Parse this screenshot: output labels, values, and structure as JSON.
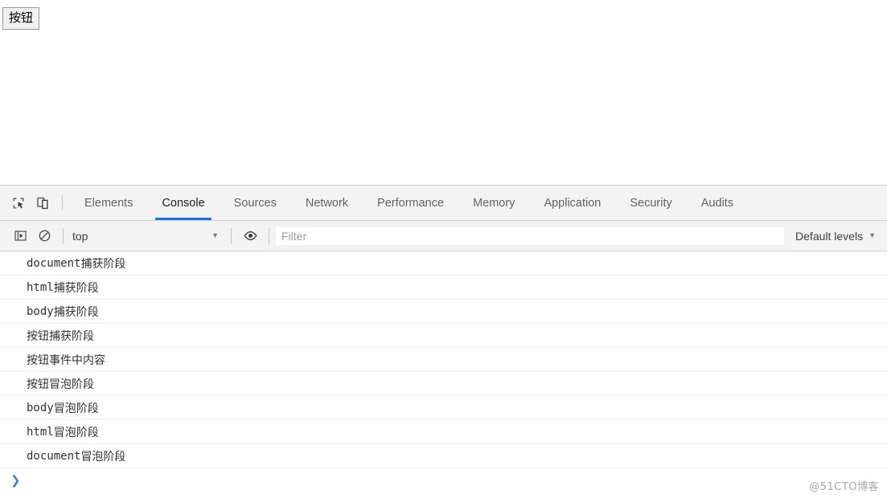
{
  "page": {
    "button_label": "按钮"
  },
  "devtools": {
    "toolbar_icons": [
      {
        "name": "inspect-element-icon"
      },
      {
        "name": "device-toolbar-icon"
      }
    ],
    "tabs": [
      {
        "label": "Elements",
        "active": false
      },
      {
        "label": "Console",
        "active": true
      },
      {
        "label": "Sources",
        "active": false
      },
      {
        "label": "Network",
        "active": false
      },
      {
        "label": "Performance",
        "active": false
      },
      {
        "label": "Memory",
        "active": false
      },
      {
        "label": "Application",
        "active": false
      },
      {
        "label": "Security",
        "active": false
      },
      {
        "label": "Audits",
        "active": false
      }
    ],
    "accent_color": "#1a73e8",
    "console_toolbar": {
      "sidebar_toggle_icon": "console-sidebar-icon",
      "clear_console_icon": "clear-console-icon",
      "context_value": "top",
      "context_caret": "▼",
      "eye_icon": "eye-icon",
      "filter_placeholder": "Filter",
      "filter_value": "",
      "levels_label": "Default levels",
      "levels_caret": "▼"
    },
    "console_messages": [
      {
        "mono": "document",
        "cjk": "捕获阶段"
      },
      {
        "mono": "html",
        "cjk": "捕获阶段"
      },
      {
        "mono": "body",
        "cjk": "捕获阶段"
      },
      {
        "mono": "",
        "cjk": "按钮捕获阶段"
      },
      {
        "mono": "",
        "cjk": "按钮事件中内容"
      },
      {
        "mono": "",
        "cjk": "按钮冒泡阶段"
      },
      {
        "mono": "body",
        "cjk": "冒泡阶段"
      },
      {
        "mono": "html",
        "cjk": "冒泡阶段"
      },
      {
        "mono": "document",
        "cjk": "冒泡阶段"
      }
    ],
    "prompt_symbol": "❯"
  },
  "watermark": "@51CTO博客"
}
